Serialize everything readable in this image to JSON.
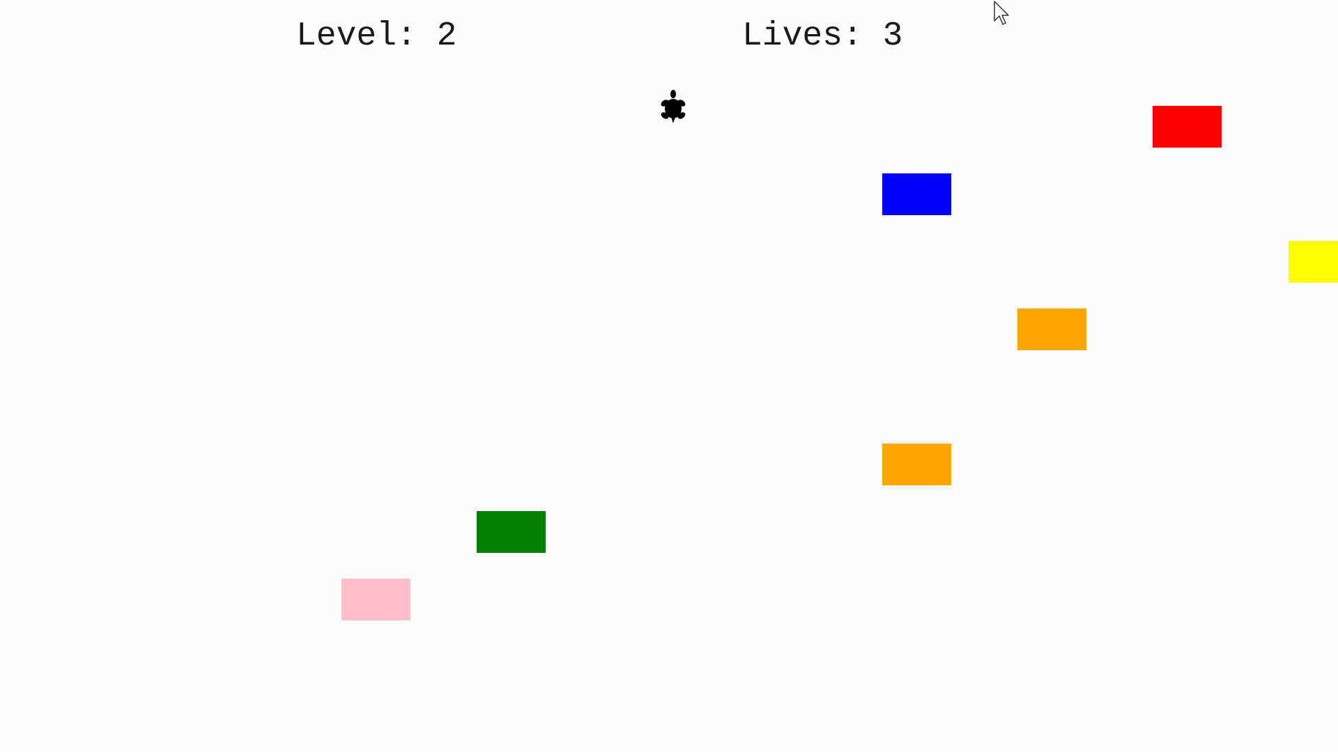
{
  "hud": {
    "level_label": "Level:",
    "level_value": "2",
    "lives_label": "Lives:",
    "lives_value": "3"
  },
  "player": {
    "icon": "turtle-icon",
    "color": "#000000"
  },
  "cursor": {
    "icon": "mouse-pointer-icon"
  },
  "cars": [
    {
      "color": "#ff0000"
    },
    {
      "color": "#0000ff"
    },
    {
      "color": "#ffff00"
    },
    {
      "color": "#ffa500"
    },
    {
      "color": "#ffa500"
    },
    {
      "color": "#008000"
    },
    {
      "color": "#ffc0cb"
    }
  ],
  "colors": {
    "background": "#fcfcfc",
    "text": "#1a1a1a"
  }
}
